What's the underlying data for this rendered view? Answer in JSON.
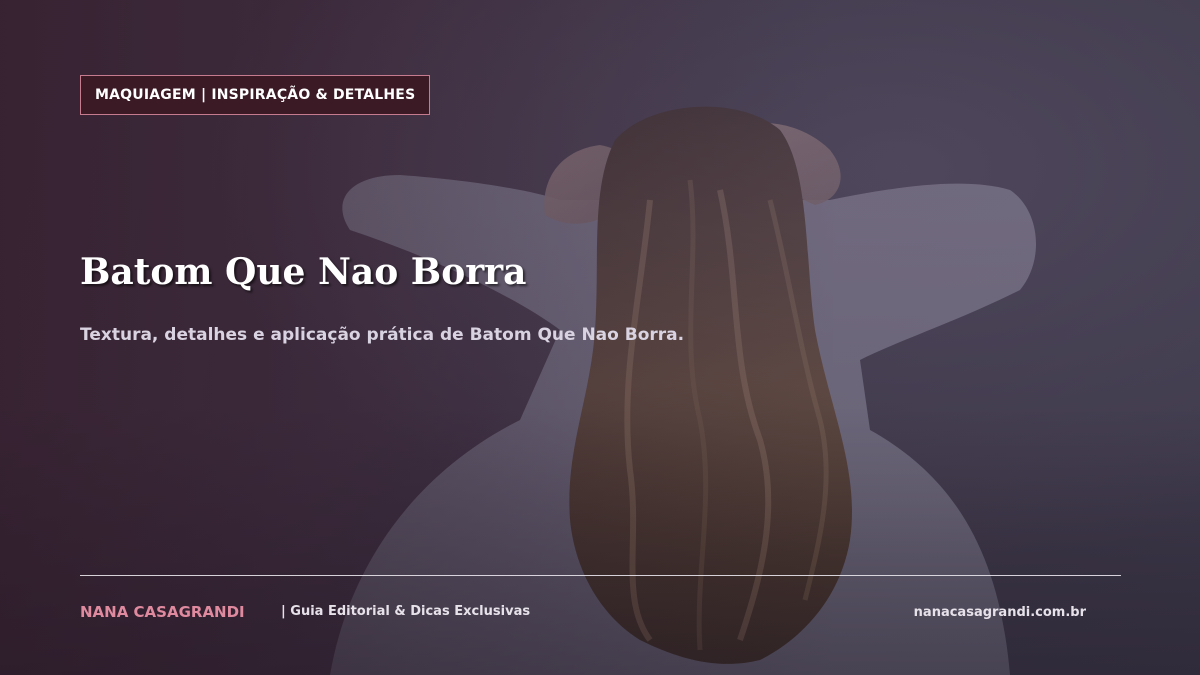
{
  "category": {
    "label": "MAQUIAGEM | INSPIRAÇÃO & DETALHES"
  },
  "hero": {
    "title": "Batom Que Nao Borra",
    "subtitle": "Textura, detalhes e aplicação prática de Batom Que Nao Borra."
  },
  "footer": {
    "brand": "NANA CASAGRANDI",
    "tagline": "| Guia Editorial & Dicas Exclusivas",
    "url": "nanacasagrandi.com.br"
  },
  "colors": {
    "badge_background": "#3b1a25",
    "badge_border": "#c77b8f",
    "brand_accent": "#e08aa0",
    "overlay": "#453548"
  }
}
